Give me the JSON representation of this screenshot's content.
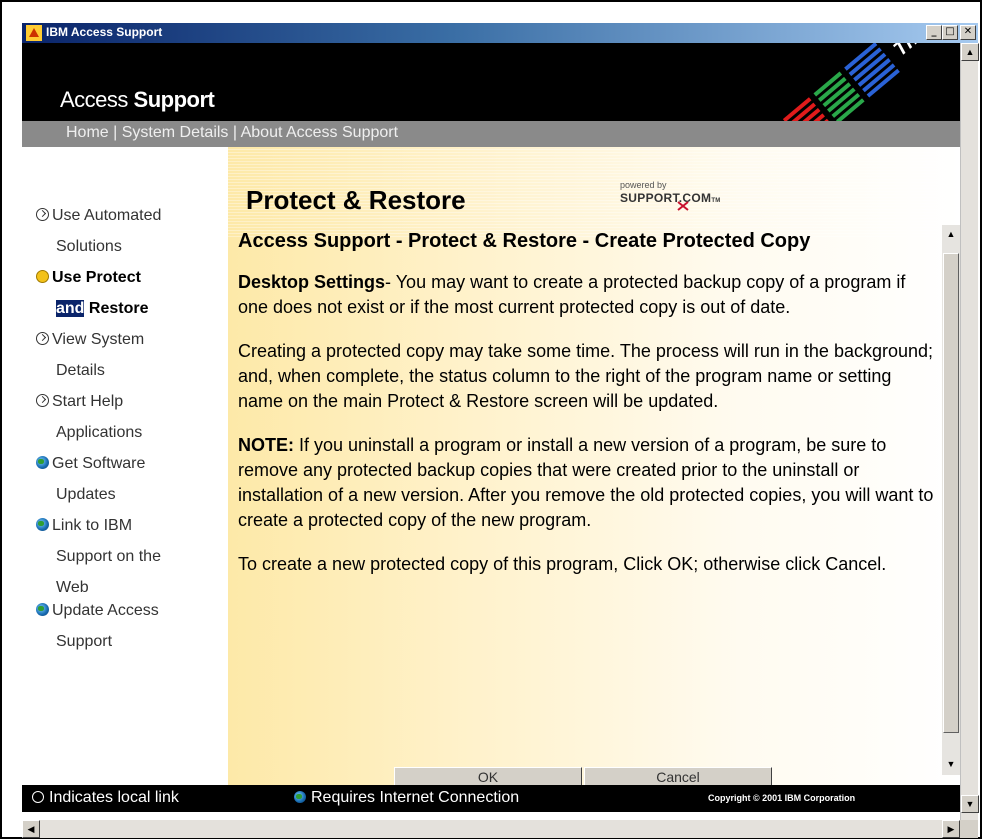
{
  "window": {
    "title": "IBM Access Support",
    "minimize_glyph": "_",
    "maximize_glyph": "□",
    "close_glyph": "✕"
  },
  "header": {
    "brand_light": "Access ",
    "brand_bold": "Support",
    "logo_letters": "IBM",
    "logo_product": "ThinkPad"
  },
  "nav": {
    "home": "Home",
    "sep1": " | ",
    "system_details": "System Details",
    "sep2": " | ",
    "about": "About Access Support"
  },
  "sidebar": {
    "items": [
      {
        "line1": "Use Automated",
        "line2": "Solutions",
        "icon": "local-link-icon"
      },
      {
        "line1": "Use Protect",
        "line2_hl": "and",
        "line2_rest": " Restore",
        "icon": "current-page-icon"
      },
      {
        "line1": "View System",
        "line2": "Details",
        "icon": "local-link-icon"
      },
      {
        "line1": "Start Help",
        "line2": "Applications",
        "icon": "local-link-icon"
      },
      {
        "line1": "Get Software",
        "line2": "Updates",
        "icon": "globe-icon"
      },
      {
        "line1": "Link to IBM",
        "line2": "Support on the",
        "line3": "Web",
        "icon": "globe-icon"
      },
      {
        "line1": "Update Access",
        "line2": "Support",
        "icon": "globe-icon"
      }
    ]
  },
  "content": {
    "heading": "Protect & Restore",
    "powered_by": "powered by",
    "support_com": "SUPPORT.COM",
    "tm": "TM",
    "sub_heading": "Access Support - Protect & Restore - Create Protected Copy",
    "p1_bold": "Desktop Settings",
    "p1_text": "- You may want to create a protected backup copy of a program if one does not exist or if the most current protected copy is out of date.",
    "p2_text": "Creating a protected copy may take some time. The process will run in the background; and, when complete, the status column to the right of the program name or setting name on the main Protect & Restore screen will be updated.",
    "p3_bold": "NOTE:",
    "p3_text": " If you uninstall a program or install a new version of a program, be sure to remove any protected backup copies that were created prior to the uninstall or installation of a new version. After you remove the old protected copies, you will want to create a protected copy of the new program.",
    "p4_text": "To create a new protected copy of this program, Click OK; otherwise click Cancel.",
    "ok_label": "OK",
    "cancel_label": "Cancel"
  },
  "footer": {
    "local_legend": "Indicates local link",
    "internet_legend": "Requires Internet Connection",
    "copyright": "Copyright © 2001 IBM Corporation"
  },
  "scrollbar": {
    "up_glyph": "▲",
    "down_glyph": "▼",
    "left_glyph": "◀",
    "right_glyph": "▶"
  },
  "colors": {
    "header_bg": "#000000",
    "nav_bg": "#8a8a8a",
    "title_bar": "#0a246a",
    "content_tint": "#fde9a8"
  }
}
